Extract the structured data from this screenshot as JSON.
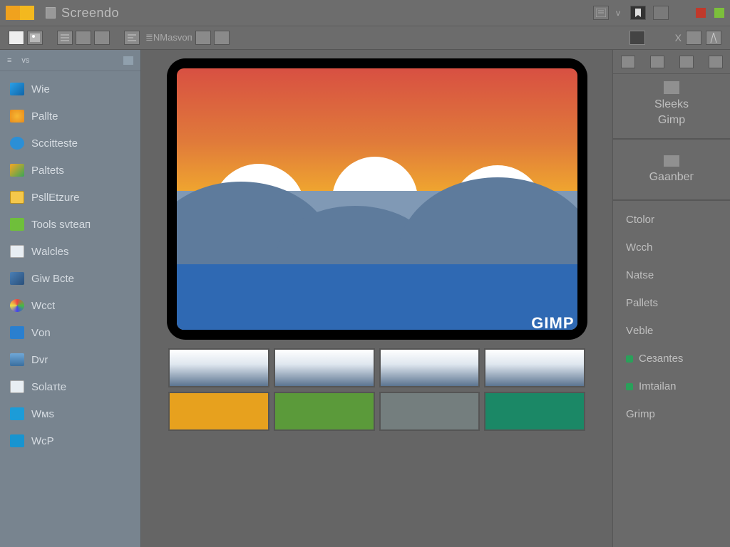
{
  "titlebar": {
    "swatches": [
      "#f0a21e",
      "#f3b81f"
    ],
    "title": "Screendo",
    "win_close": "#c0392b",
    "win_max": "#7cbf3b"
  },
  "toolbar": {
    "mask_label": "≣NMаsvоп"
  },
  "sidebar": {
    "tab1": "vs",
    "items": [
      {
        "label": "Wie"
      },
      {
        "label": "Pallte"
      },
      {
        "label": "Sccitteste"
      },
      {
        "label": "Paltets"
      },
      {
        "label": "PsllEtzure"
      },
      {
        "label": "Tools svtеaп"
      },
      {
        "label": "Wаlсles"
      },
      {
        "label": "Giw Bсte"
      },
      {
        "label": "Wсct"
      },
      {
        "label": "Vоn"
      },
      {
        "label": "Dvr"
      },
      {
        "label": "Solатtе"
      },
      {
        "label": "Wмs"
      },
      {
        "label": "WсP"
      }
    ]
  },
  "canvas": {
    "brand": "GIMP"
  },
  "palette": {
    "row2": [
      "#e7a11e",
      "#5b9a3a",
      "#747e7e",
      "#1b8866"
    ]
  },
  "rsidebar": {
    "section1": [
      "Slеeks",
      "Gimp"
    ],
    "section2_label": "Gаanbeг",
    "list": [
      {
        "label": "Ctolor"
      },
      {
        "label": "Wсch"
      },
      {
        "label": "Natsе"
      },
      {
        "label": "Pallеts"
      },
      {
        "label": "Vеblе"
      },
      {
        "label": "Сезаntes",
        "dot": "#2aa05a"
      },
      {
        "label": "Imtаilаn",
        "dot": "#2aa05a"
      },
      {
        "label": "Grimp"
      }
    ]
  }
}
